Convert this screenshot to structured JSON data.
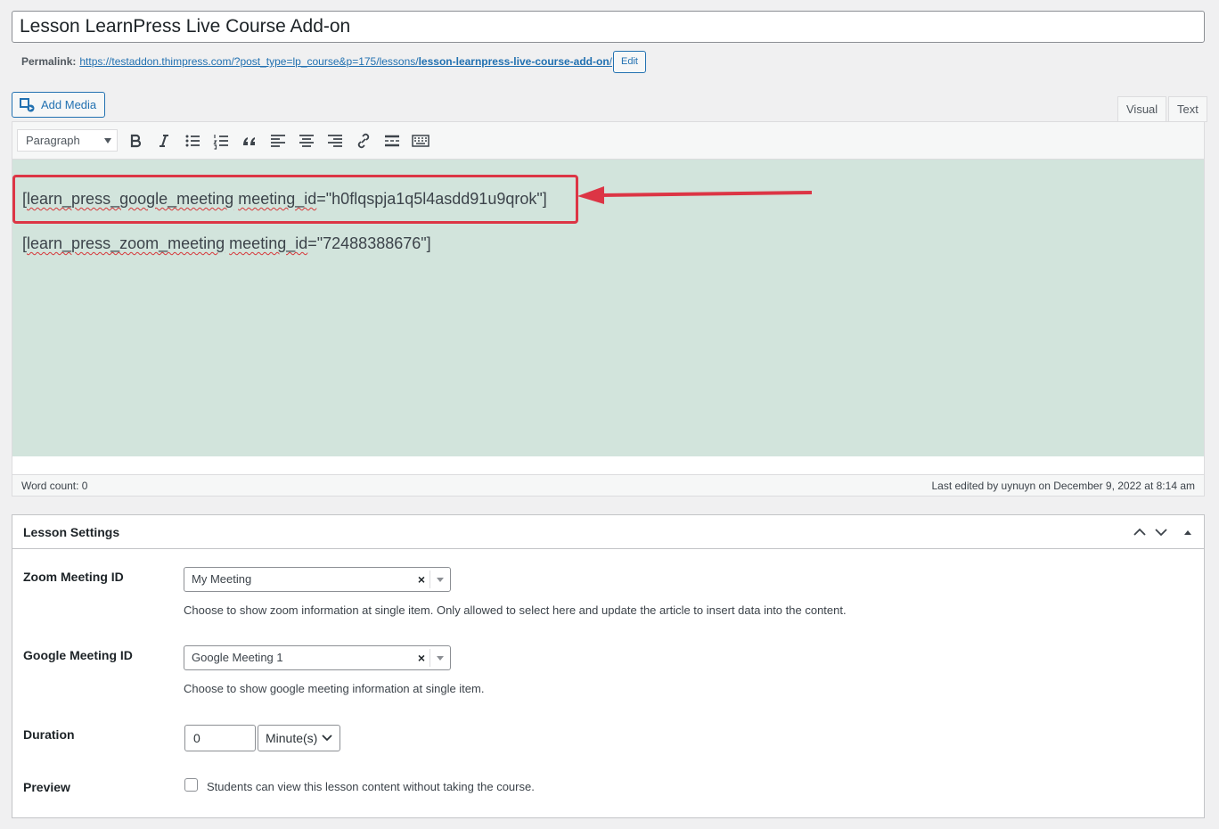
{
  "post_title": "Lesson LearnPress Live Course Add-on",
  "permalink": {
    "label": "Permalink:",
    "url_base": "https://testaddon.thimpress.com/?post_type=lp_course&p=175/lessons/",
    "url_slug": "lesson-learnpress-live-course-add-on",
    "url_end": "/",
    "edit_label": "Edit"
  },
  "toolbar": {
    "add_media_label": "Add Media",
    "tab_visual": "Visual",
    "tab_text": "Text",
    "format_value": "Paragraph"
  },
  "editor": {
    "line1_open": "[",
    "line1_tag": "learn_press_google_meeting",
    "line1_attr": "meeting_id",
    "line1_value": "=\"h0flqspja1q5l4asdd91u9qrok\"]",
    "line2_open": "[",
    "line2_tag": "learn_press_zoom_meeting",
    "line2_attr": "meeting_id",
    "line2_value": "=\"72488388676\"]",
    "word_count": "Word count: 0",
    "last_edited": "Last edited by uynuyn on December 9, 2022 at 8:14 am",
    "highlight_color": "#dc3545"
  },
  "settings": {
    "title": "Lesson Settings",
    "zoom": {
      "label": "Zoom Meeting ID",
      "value": "My Meeting",
      "clear": "×",
      "desc": "Choose to show zoom information at single item. Only allowed to select here and update the article to insert data into the content."
    },
    "google": {
      "label": "Google Meeting ID",
      "value": "Google Meeting 1",
      "clear": "×",
      "desc": "Choose to show google meeting information at single item."
    },
    "duration": {
      "label": "Duration",
      "value": "0",
      "unit": "Minute(s)"
    },
    "preview": {
      "label": "Preview",
      "checkbox_text": "Students can view this lesson content without taking the course."
    }
  }
}
